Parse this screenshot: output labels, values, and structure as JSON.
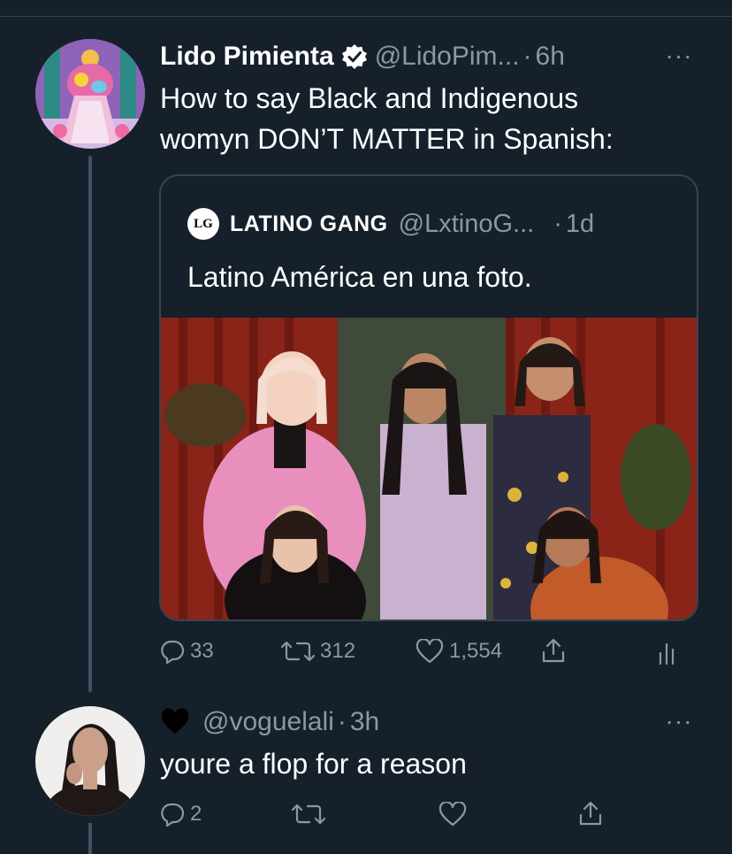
{
  "tweet": {
    "author_name": "Lido Pimienta",
    "handle": "@LidoPim...",
    "separator": "·",
    "time": "6h",
    "more": "···",
    "text_line1": "How to say Black and Indigenous",
    "text_line2": "womyn DON’T MATTER in Spanish:",
    "quoted": {
      "logo_text": "LG",
      "author_name": "LATINO GANG",
      "handle": "@LxtinoG...",
      "separator": "·",
      "time": "1d",
      "text": "Latino América en una foto."
    },
    "actions": {
      "replies": "33",
      "retweets": "312",
      "likes": "1,554"
    }
  },
  "reply": {
    "emoji": "black-heart",
    "handle": "@voguelali",
    "separator": "·",
    "time": "3h",
    "more": "···",
    "text": "youre a flop for a reason",
    "actions": {
      "replies": "2"
    }
  },
  "colors": {
    "background": "#15202b",
    "text_primary": "#ffffff",
    "text_secondary": "#8899a6",
    "border": "#38444d",
    "verified_badge": "#ffffff"
  }
}
